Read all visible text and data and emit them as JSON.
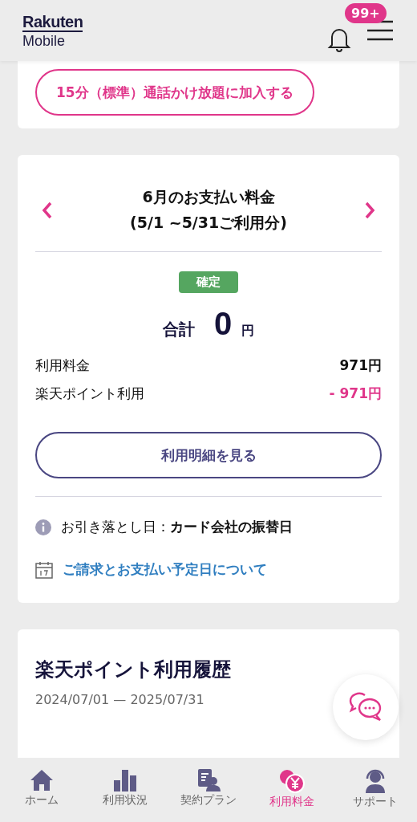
{
  "header": {
    "logo_top": "Rakuten",
    "logo_bottom": "Mobile",
    "notification_badge": "99+"
  },
  "promo": {
    "button": "15分（標準）通話かけ放題に加入する"
  },
  "bill": {
    "title": "6月のお支払い料金",
    "period": "(5/1 ~5/31ご利用分)",
    "status": "確定",
    "total_label": "合計",
    "total_value": "0",
    "total_unit": "円",
    "lines": [
      {
        "label": "利用料金",
        "value": "971円",
        "kind": "charge"
      },
      {
        "label": "楽天ポイント利用",
        "value": "- 971円",
        "kind": "discount"
      }
    ],
    "details_button": "利用明細を見る",
    "debit_note": "お引き落とし日：**カード会社の振替日**",
    "schedule_link": "ご請求とお支払い予定日について"
  },
  "points": {
    "title": "楽天ポイント利用履歴",
    "range": "2024/07/01 — 2025/07/31"
  },
  "tabs": [
    {
      "label": "ホーム",
      "kind": "home",
      "selected": false
    },
    {
      "label": "利用状況",
      "kind": "usage",
      "selected": false
    },
    {
      "label": "契約プラン",
      "kind": "plan",
      "selected": false
    },
    {
      "label": "利用料金",
      "kind": "fee",
      "selected": true
    },
    {
      "label": "サポート",
      "kind": "support",
      "selected": false
    }
  ]
}
